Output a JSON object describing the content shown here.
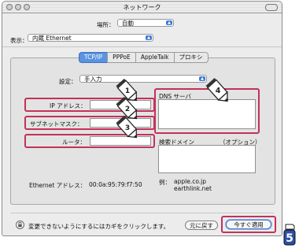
{
  "window": {
    "title": "ネットワーク"
  },
  "location": {
    "label": "場所：",
    "value": "自動"
  },
  "show": {
    "label": "表示：",
    "value": "内蔵 Ethernet"
  },
  "tabs": [
    {
      "label": "TCP/IP",
      "active": true
    },
    {
      "label": "PPPoE",
      "active": false
    },
    {
      "label": "AppleTalk",
      "active": false
    },
    {
      "label": "プロキシ",
      "active": false
    }
  ],
  "settings": {
    "label": "設定：",
    "value": "手入力"
  },
  "fields": {
    "ip_label": "IP アドレス：",
    "ip_value": "",
    "subnet_label": "サブネットマスク：",
    "subnet_value": "",
    "router_label": "ルータ：",
    "router_value": ""
  },
  "dns": {
    "label": "DNS サーバ",
    "value": ""
  },
  "search": {
    "label": "検索ドメイン",
    "optional": "（オプション）",
    "value": ""
  },
  "example": {
    "label": "例：",
    "line1": "apple.co.jp",
    "line2": "earthlink.net"
  },
  "ethernet": {
    "label": "Ethernet アドレス：",
    "value": "00:0a:95:79:f7:50"
  },
  "footer": {
    "lock_text": "変更できないようにするにはカギをクリックします。",
    "revert_label": "元に戻す",
    "apply_label": "今すぐ適用"
  },
  "callouts": [
    "1",
    "2",
    "3",
    "4"
  ],
  "step_badge": "5",
  "colors": {
    "accent": "#5a93e0",
    "highlight": "#c2325a",
    "popup_arrow": "#3b7bd6"
  },
  "icons": [
    "lock-icon",
    "pencil-icon",
    "popup-arrow-icon",
    "step-badge-icon"
  ]
}
